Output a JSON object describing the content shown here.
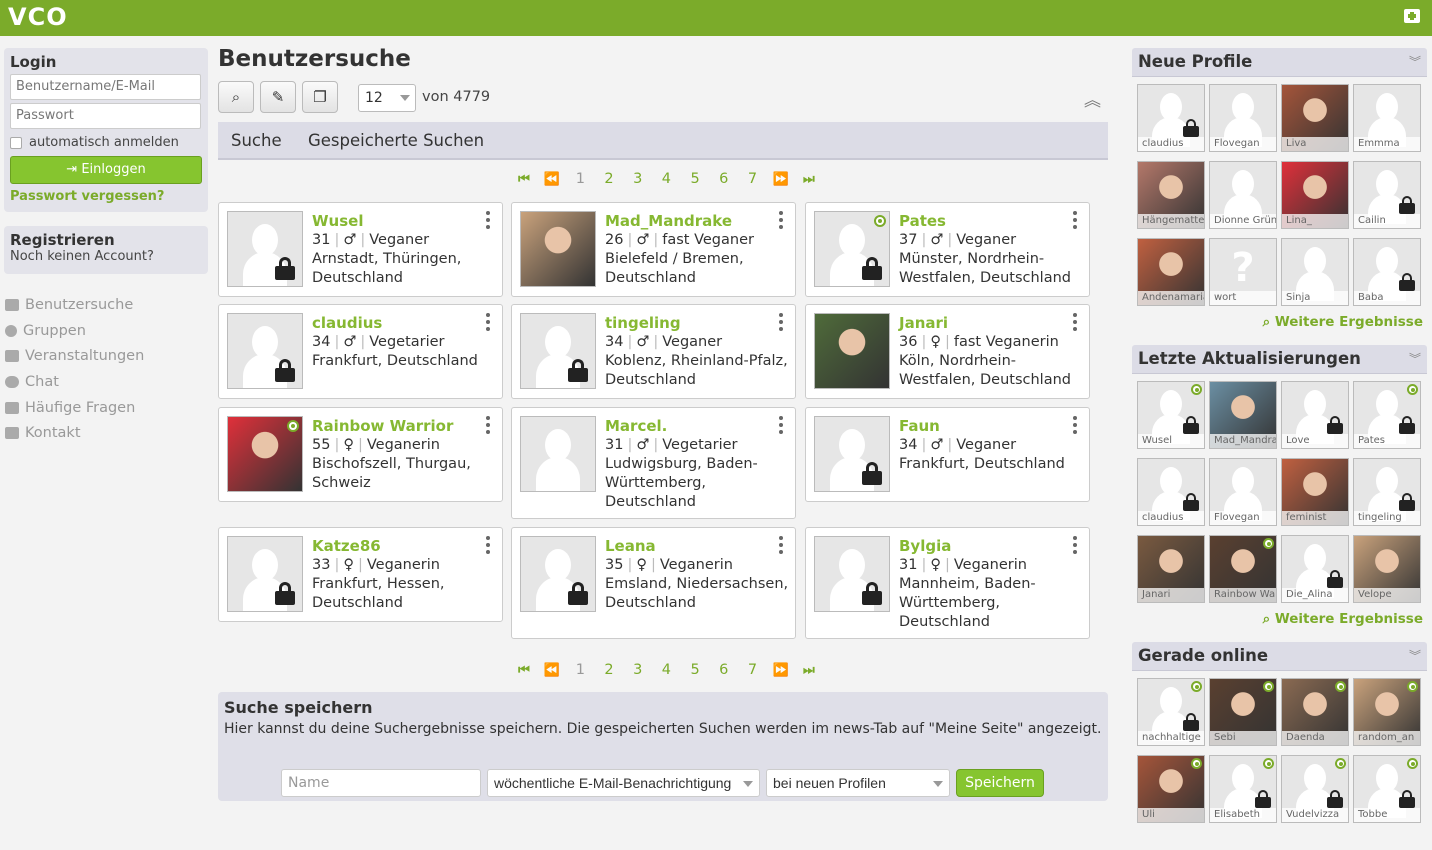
{
  "header": {
    "logo": "VCO",
    "colors": {
      "brand": "#7bab2a",
      "button": "#86c52f"
    }
  },
  "login": {
    "title": "Login",
    "username_placeholder": "Benutzername/E-Mail",
    "password_placeholder": "Passwort",
    "remember_label": "automatisch anmelden",
    "login_button": "Einloggen",
    "forgot_link": "Passwort vergessen?"
  },
  "register": {
    "title": "Registrieren",
    "subtitle": "Noch keinen Account?"
  },
  "nav": {
    "items": [
      {
        "label": "Benutzersuche",
        "icon": "folder-icon"
      },
      {
        "label": "Gruppen",
        "icon": "globe-icon"
      },
      {
        "label": "Veranstaltungen",
        "icon": "calendar-icon"
      },
      {
        "label": "Chat",
        "icon": "chat-icon"
      },
      {
        "label": "Häufige Fragen",
        "icon": "medkit-icon"
      },
      {
        "label": "Kontakt",
        "icon": "gamepad-icon"
      }
    ]
  },
  "main": {
    "title": "Benutzersuche",
    "per_page": "12",
    "total_label": "von 4779",
    "tabs": [
      "Suche",
      "Gespeicherte Suchen"
    ],
    "pager": {
      "pages": [
        "1",
        "2",
        "3",
        "4",
        "5",
        "6",
        "7"
      ],
      "current": "1"
    }
  },
  "results": [
    {
      "name": "Wusel",
      "age": "31",
      "gender": "♂",
      "diet": "Veganer",
      "location": "Arnstadt, Thüringen, Deutschland",
      "photo": false,
      "locked": true,
      "online": false
    },
    {
      "name": "Mad_Mandrake",
      "age": "26",
      "gender": "♂",
      "diet": "fast Veganer",
      "location": "Bielefeld / Bremen, Deutschland",
      "photo": true,
      "locked": false,
      "online": false
    },
    {
      "name": "Pates",
      "age": "37",
      "gender": "♂",
      "diet": "Veganer",
      "location": "Münster, Nordrhein-Westfalen, Deutschland",
      "photo": false,
      "locked": true,
      "online": true
    },
    {
      "name": "claudius",
      "age": "34",
      "gender": "♂",
      "diet": "Vegetarier",
      "location": "Frankfurt, Deutschland",
      "photo": false,
      "locked": true,
      "online": false
    },
    {
      "name": "tingeling",
      "age": "34",
      "gender": "♂",
      "diet": "Veganer",
      "location": "Koblenz, Rheinland-Pfalz, Deutschland",
      "photo": false,
      "locked": true,
      "online": false
    },
    {
      "name": "Janari",
      "age": "36",
      "gender": "♀",
      "diet": "fast Veganerin",
      "location": "Köln, Nordrhein-Westfalen, Deutschland",
      "photo": true,
      "locked": false,
      "online": false
    },
    {
      "name": "Rainbow Warrior",
      "age": "55",
      "gender": "♀",
      "diet": "Veganerin",
      "location": "Bischofszell, Thurgau, Schweiz",
      "photo": true,
      "locked": false,
      "online": true
    },
    {
      "name": "Marcel.",
      "age": "31",
      "gender": "♂",
      "diet": "Vegetarier",
      "location": "Ludwigsburg, Baden-Württemberg, Deutschland",
      "photo": false,
      "locked": false,
      "online": false
    },
    {
      "name": "Faun",
      "age": "34",
      "gender": "♂",
      "diet": "Veganer",
      "location": "Frankfurt, Deutschland",
      "photo": false,
      "locked": true,
      "online": false
    },
    {
      "name": "Katze86",
      "age": "33",
      "gender": "♀",
      "diet": "Veganerin",
      "location": "Frankfurt, Hessen, Deutschland",
      "photo": false,
      "locked": true,
      "online": false
    },
    {
      "name": "Leana",
      "age": "35",
      "gender": "♀",
      "diet": "Veganerin",
      "location": "Emsland, Niedersachsen, Deutschland",
      "photo": false,
      "locked": true,
      "online": false
    },
    {
      "name": "Bylgia",
      "age": "31",
      "gender": "♀",
      "diet": "Veganerin",
      "location": "Mannheim, Baden-Württemberg, Deutschland",
      "photo": false,
      "locked": true,
      "online": false
    }
  ],
  "save_search": {
    "title": "Suche speichern",
    "text": "Hier kannst du deine Suchergebnisse speichern. Die gespeicherten Suchen werden im news-Tab auf \"Meine Seite\" angezeigt.",
    "name_placeholder": "Name",
    "notify_value": "wöchentliche E-Mail-Benachrichtigung",
    "trigger_value": "bei neuen Profilen",
    "save_button": "Speichern"
  },
  "sidebar": {
    "new_profiles": {
      "title": "Neue Profile",
      "more": "Weitere Ergebnisse",
      "items": [
        {
          "label": "claudius",
          "photo": false,
          "locked": true,
          "online": false
        },
        {
          "label": "Flovegan",
          "photo": false,
          "locked": false,
          "online": false
        },
        {
          "label": "Liva",
          "photo": true,
          "locked": false,
          "online": false
        },
        {
          "label": "Emmma",
          "photo": false,
          "locked": false,
          "online": false
        },
        {
          "label": "Hängematte",
          "photo": true,
          "locked": false,
          "online": false
        },
        {
          "label": "Dionne Grün",
          "photo": false,
          "locked": false,
          "online": false
        },
        {
          "label": "Lina_",
          "photo": true,
          "locked": false,
          "online": false
        },
        {
          "label": "Cailin",
          "photo": false,
          "locked": true,
          "online": false
        },
        {
          "label": "Andenamaria",
          "photo": true,
          "locked": false,
          "online": false
        },
        {
          "label": "wort",
          "photo": false,
          "locked": false,
          "online": false,
          "question": true
        },
        {
          "label": "Sinja",
          "photo": false,
          "locked": false,
          "online": false
        },
        {
          "label": "Baba",
          "photo": false,
          "locked": true,
          "online": false
        }
      ]
    },
    "recent_updates": {
      "title": "Letzte Aktualisierungen",
      "more": "Weitere Ergebnisse",
      "items": [
        {
          "label": "Wusel",
          "photo": false,
          "locked": true,
          "online": true
        },
        {
          "label": "Mad_Mandrake",
          "photo": true,
          "locked": false,
          "online": false
        },
        {
          "label": "Love",
          "photo": false,
          "locked": true,
          "online": false
        },
        {
          "label": "Pates",
          "photo": false,
          "locked": true,
          "online": true
        },
        {
          "label": "claudius",
          "photo": false,
          "locked": true,
          "online": false
        },
        {
          "label": "Flovegan",
          "photo": false,
          "locked": false,
          "online": false
        },
        {
          "label": "feminist",
          "photo": true,
          "locked": false,
          "online": false
        },
        {
          "label": "tingeling",
          "photo": false,
          "locked": true,
          "online": false
        },
        {
          "label": "Janari",
          "photo": true,
          "locked": false,
          "online": false
        },
        {
          "label": "Rainbow Warrior",
          "photo": true,
          "locked": false,
          "online": true
        },
        {
          "label": "Die_Alina",
          "photo": false,
          "locked": true,
          "online": false
        },
        {
          "label": "Velope",
          "photo": true,
          "locked": false,
          "online": false
        }
      ]
    },
    "online_now": {
      "title": "Gerade online",
      "items": [
        {
          "label": "nachhaltige",
          "photo": false,
          "locked": true,
          "online": true
        },
        {
          "label": "Sebi",
          "photo": true,
          "locked": false,
          "online": true
        },
        {
          "label": "Daenda",
          "photo": true,
          "locked": false,
          "online": true
        },
        {
          "label": "random_an",
          "photo": true,
          "locked": false,
          "online": true
        },
        {
          "label": "Uli",
          "photo": true,
          "locked": false,
          "online": true
        },
        {
          "label": "Elisabeth",
          "photo": false,
          "locked": true,
          "online": true
        },
        {
          "label": "Vudelvizza",
          "photo": false,
          "locked": true,
          "online": true
        },
        {
          "label": "Tobbe",
          "photo": false,
          "locked": true,
          "online": true
        }
      ]
    }
  }
}
